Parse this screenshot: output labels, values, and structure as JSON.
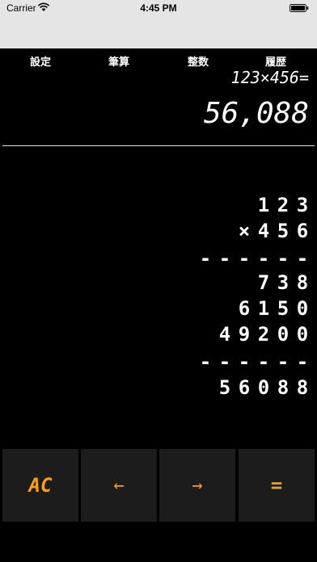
{
  "status": {
    "carrier": "Carrier",
    "time": "4:45 PM"
  },
  "menu": {
    "settings": "設定",
    "written": "筆算",
    "integer": "整数",
    "history": "履歴"
  },
  "display": {
    "expression": "123×456=",
    "result": "56,088"
  },
  "long_multiplication": {
    "rows": [
      [
        "1",
        "2",
        "3"
      ],
      [
        "×",
        "4",
        "5",
        "6"
      ],
      [
        "-",
        "-",
        "-",
        "-",
        "-",
        "-"
      ],
      [
        "7",
        "3",
        "8"
      ],
      [
        "6",
        "1",
        "5",
        "0"
      ],
      [
        "4",
        "9",
        "2",
        "0",
        "0"
      ],
      [
        "-",
        "-",
        "-",
        "-",
        "-",
        "-"
      ],
      [
        "5",
        "6",
        "0",
        "8",
        "8"
      ]
    ]
  },
  "keys": {
    "ac": "AC",
    "back": "←",
    "forward": "→",
    "equals": "="
  },
  "colors": {
    "accent": "#f5a010",
    "background": "#000000",
    "key_background": "#1c1c1c",
    "status_bar": "#e5e5e5"
  }
}
